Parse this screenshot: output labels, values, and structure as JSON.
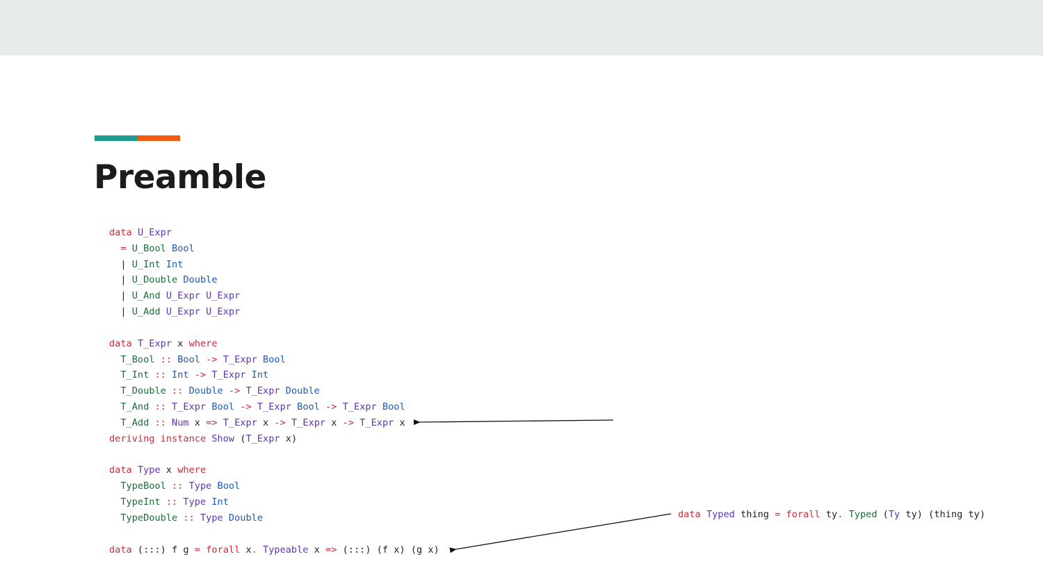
{
  "slide": {
    "title": "Preamble",
    "accent_colors": [
      "#1f9a8e",
      "#ee5b0f"
    ]
  },
  "code_colors": {
    "keyword": "#cc2a3a",
    "type": "#5e35b1",
    "constructor": "#1d6b3a",
    "builtin": "#1a5ab3"
  },
  "code_lines": [
    [
      [
        "k",
        "data"
      ],
      [
        "p",
        " "
      ],
      [
        "t",
        "U_Expr"
      ]
    ],
    [
      [
        "p",
        "  "
      ],
      [
        "k",
        "="
      ],
      [
        "p",
        " "
      ],
      [
        "c",
        "U_Bool"
      ],
      [
        "p",
        " "
      ],
      [
        "b",
        "Bool"
      ]
    ],
    [
      [
        "p",
        "  | "
      ],
      [
        "c",
        "U_Int"
      ],
      [
        "p",
        " "
      ],
      [
        "b",
        "Int"
      ]
    ],
    [
      [
        "p",
        "  | "
      ],
      [
        "c",
        "U_Double"
      ],
      [
        "p",
        " "
      ],
      [
        "b",
        "Double"
      ]
    ],
    [
      [
        "p",
        "  | "
      ],
      [
        "c",
        "U_And"
      ],
      [
        "p",
        " "
      ],
      [
        "t",
        "U_Expr"
      ],
      [
        "p",
        " "
      ],
      [
        "t",
        "U_Expr"
      ]
    ],
    [
      [
        "p",
        "  | "
      ],
      [
        "c",
        "U_Add"
      ],
      [
        "p",
        " "
      ],
      [
        "t",
        "U_Expr"
      ],
      [
        "p",
        " "
      ],
      [
        "t",
        "U_Expr"
      ]
    ],
    [],
    [
      [
        "k",
        "data"
      ],
      [
        "p",
        " "
      ],
      [
        "t",
        "T_Expr"
      ],
      [
        "p",
        " x "
      ],
      [
        "k",
        "where"
      ]
    ],
    [
      [
        "p",
        "  "
      ],
      [
        "c",
        "T_Bool"
      ],
      [
        "p",
        " "
      ],
      [
        "k",
        "::"
      ],
      [
        "p",
        " "
      ],
      [
        "b",
        "Bool"
      ],
      [
        "p",
        " "
      ],
      [
        "k",
        "->"
      ],
      [
        "p",
        " "
      ],
      [
        "t",
        "T_Expr"
      ],
      [
        "p",
        " "
      ],
      [
        "b",
        "Bool"
      ]
    ],
    [
      [
        "p",
        "  "
      ],
      [
        "c",
        "T_Int"
      ],
      [
        "p",
        " "
      ],
      [
        "k",
        "::"
      ],
      [
        "p",
        " "
      ],
      [
        "b",
        "Int"
      ],
      [
        "p",
        " "
      ],
      [
        "k",
        "->"
      ],
      [
        "p",
        " "
      ],
      [
        "t",
        "T_Expr"
      ],
      [
        "p",
        " "
      ],
      [
        "b",
        "Int"
      ]
    ],
    [
      [
        "p",
        "  "
      ],
      [
        "c",
        "T_Double"
      ],
      [
        "p",
        " "
      ],
      [
        "k",
        "::"
      ],
      [
        "p",
        " "
      ],
      [
        "b",
        "Double"
      ],
      [
        "p",
        " "
      ],
      [
        "k",
        "->"
      ],
      [
        "p",
        " "
      ],
      [
        "t",
        "T_Expr"
      ],
      [
        "p",
        " "
      ],
      [
        "b",
        "Double"
      ]
    ],
    [
      [
        "p",
        "  "
      ],
      [
        "c",
        "T_And"
      ],
      [
        "p",
        " "
      ],
      [
        "k",
        "::"
      ],
      [
        "p",
        " "
      ],
      [
        "t",
        "T_Expr"
      ],
      [
        "p",
        " "
      ],
      [
        "b",
        "Bool"
      ],
      [
        "p",
        " "
      ],
      [
        "k",
        "->"
      ],
      [
        "p",
        " "
      ],
      [
        "t",
        "T_Expr"
      ],
      [
        "p",
        " "
      ],
      [
        "b",
        "Bool"
      ],
      [
        "p",
        " "
      ],
      [
        "k",
        "->"
      ],
      [
        "p",
        " "
      ],
      [
        "t",
        "T_Expr"
      ],
      [
        "p",
        " "
      ],
      [
        "b",
        "Bool"
      ]
    ],
    [
      [
        "p",
        "  "
      ],
      [
        "c",
        "T_Add"
      ],
      [
        "p",
        " "
      ],
      [
        "k",
        "::"
      ],
      [
        "p",
        " "
      ],
      [
        "t",
        "Num"
      ],
      [
        "p",
        " x "
      ],
      [
        "k",
        "=>"
      ],
      [
        "p",
        " "
      ],
      [
        "t",
        "T_Expr"
      ],
      [
        "p",
        " x "
      ],
      [
        "k",
        "->"
      ],
      [
        "p",
        " "
      ],
      [
        "t",
        "T_Expr"
      ],
      [
        "p",
        " x "
      ],
      [
        "k",
        "->"
      ],
      [
        "p",
        " "
      ],
      [
        "t",
        "T_Expr"
      ],
      [
        "p",
        " x"
      ]
    ],
    [
      [
        "k",
        "deriving"
      ],
      [
        "p",
        " "
      ],
      [
        "k",
        "instance"
      ],
      [
        "p",
        " "
      ],
      [
        "t",
        "Show"
      ],
      [
        "p",
        " ("
      ],
      [
        "t",
        "T_Expr"
      ],
      [
        "p",
        " x)"
      ]
    ],
    [],
    [
      [
        "k",
        "data"
      ],
      [
        "p",
        " "
      ],
      [
        "t",
        "Type"
      ],
      [
        "p",
        " x "
      ],
      [
        "k",
        "where"
      ]
    ],
    [
      [
        "p",
        "  "
      ],
      [
        "c",
        "TypeBool"
      ],
      [
        "p",
        " "
      ],
      [
        "k",
        "::"
      ],
      [
        "p",
        " "
      ],
      [
        "t",
        "Type"
      ],
      [
        "p",
        " "
      ],
      [
        "b",
        "Bool"
      ]
    ],
    [
      [
        "p",
        "  "
      ],
      [
        "c",
        "TypeInt"
      ],
      [
        "p",
        " "
      ],
      [
        "k",
        "::"
      ],
      [
        "p",
        " "
      ],
      [
        "t",
        "Type"
      ],
      [
        "p",
        " "
      ],
      [
        "b",
        "Int"
      ]
    ],
    [
      [
        "p",
        "  "
      ],
      [
        "c",
        "TypeDouble"
      ],
      [
        "p",
        " "
      ],
      [
        "k",
        "::"
      ],
      [
        "p",
        " "
      ],
      [
        "t",
        "Type"
      ],
      [
        "p",
        " "
      ],
      [
        "b",
        "Double"
      ]
    ],
    [],
    [
      [
        "k",
        "data"
      ],
      [
        "p",
        " (:::) f g "
      ],
      [
        "k",
        "="
      ],
      [
        "p",
        " "
      ],
      [
        "k",
        "forall"
      ],
      [
        "p",
        " x"
      ],
      [
        "k",
        "."
      ],
      [
        "p",
        " "
      ],
      [
        "t",
        "Typeable"
      ],
      [
        "p",
        " x "
      ],
      [
        "k",
        "=>"
      ],
      [
        "p",
        " (:::) (f x) (g x)"
      ]
    ]
  ],
  "side_code": [
    [
      [
        "k",
        "data"
      ],
      [
        "p",
        " "
      ],
      [
        "t",
        "Typed"
      ],
      [
        "p",
        " thing "
      ],
      [
        "k",
        "="
      ],
      [
        "p",
        " "
      ],
      [
        "k",
        "forall"
      ],
      [
        "p",
        " ty"
      ],
      [
        "k",
        "."
      ],
      [
        "p",
        " "
      ],
      [
        "c",
        "Typed"
      ],
      [
        "p",
        " ("
      ],
      [
        "t",
        "Ty"
      ],
      [
        "p",
        " ty) (thing ty)"
      ]
    ]
  ]
}
